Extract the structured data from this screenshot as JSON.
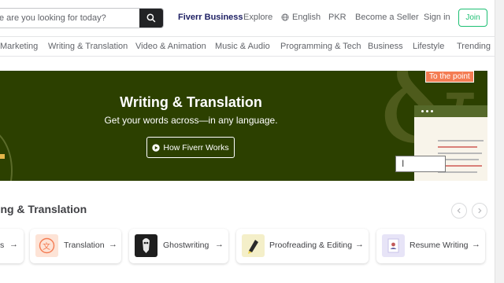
{
  "header": {
    "search_placeholder": "e are you looking for today?",
    "fiverr_business": "Fiverr Business",
    "explore": "Explore",
    "language": "English",
    "currency": "PKR",
    "become_seller": "Become a Seller",
    "sign_in": "Sign in",
    "join": "Join"
  },
  "categories": [
    "Marketing",
    "Writing & Translation",
    "Video & Animation",
    "Music & Audio",
    "Programming & Tech",
    "Business",
    "Lifestyle",
    "Trending"
  ],
  "hero": {
    "title": "Writing & Translation",
    "subtitle": "Get your words across—in any language.",
    "button": "How Fiverr Works",
    "tag": "To the point",
    "cursor": "I"
  },
  "section": {
    "title": "iting & Translation",
    "cards": [
      {
        "label": "s"
      },
      {
        "label": "Translation"
      },
      {
        "label": "Ghostwriting"
      },
      {
        "label": "Proofreading & Editing"
      },
      {
        "label": "Resume Writing"
      }
    ]
  },
  "colors": {
    "hero_bg": "#2c4000",
    "accent": "#1dbf73",
    "business": "#1d1f63",
    "tag": "#f47c53"
  }
}
